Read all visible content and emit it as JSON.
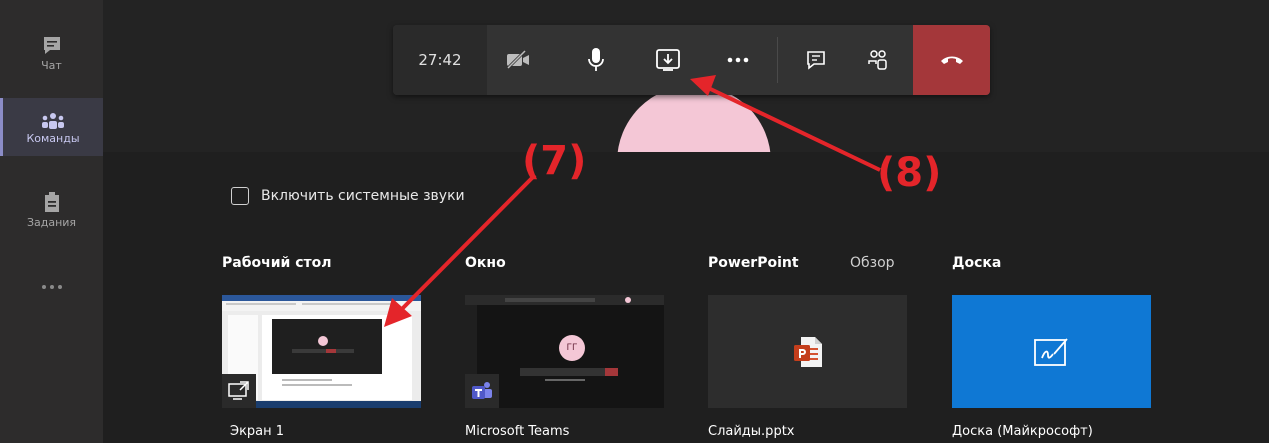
{
  "rail": {
    "items": [
      {
        "label": "Чат",
        "icon": "chat-icon"
      },
      {
        "label": "Команды",
        "icon": "teams-icon",
        "active": true
      },
      {
        "label": "Задания",
        "icon": "assignments-icon"
      },
      {
        "label": "",
        "icon": "more-icon"
      }
    ]
  },
  "toolbar": {
    "timer": "27:42",
    "buttons": [
      {
        "name": "camera-off-icon"
      },
      {
        "name": "microphone-icon"
      },
      {
        "name": "share-tray-icon"
      },
      {
        "name": "more-actions-icon"
      },
      {
        "name": "chat-icon"
      },
      {
        "name": "participants-icon"
      },
      {
        "name": "hang-up-icon"
      }
    ]
  },
  "share": {
    "system_sound_label": "Включить системные звуки",
    "sections": {
      "desktop": "Рабочий стол",
      "window": "Окно",
      "powerpoint": "PowerPoint",
      "browse": "Обзор",
      "board": "Доска"
    },
    "tiles": {
      "desktop_caption": "Экран 1",
      "window_caption": "Microsoft Teams",
      "window_avatar": "ГГ",
      "ppt_caption": "Слайды.pptx",
      "board_caption": "Доска (Майкрософт)"
    }
  },
  "annotations": {
    "label7": "(7)",
    "label8": "(8)",
    "color": "#e4252a"
  },
  "colors": {
    "hangup": "#a4373a",
    "board_tile": "#0f78d4",
    "rail_active": "#8b8cc7"
  }
}
